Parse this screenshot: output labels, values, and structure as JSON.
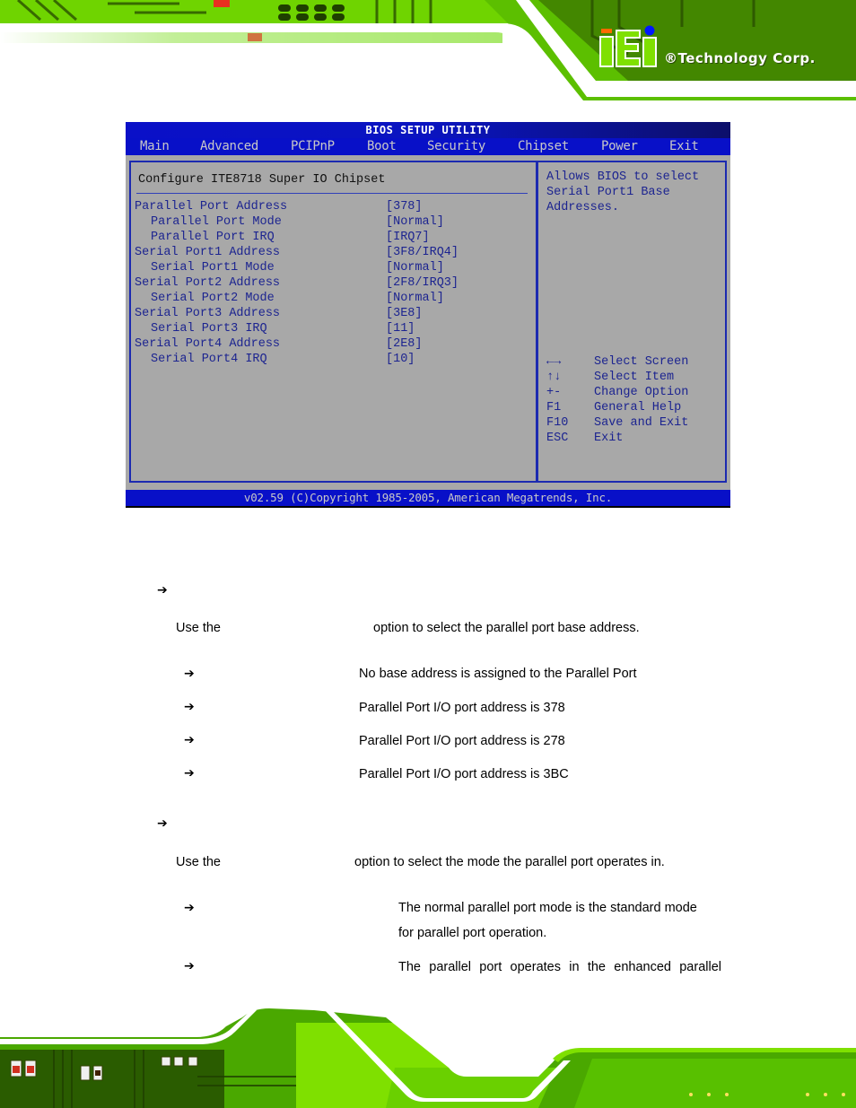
{
  "header": {
    "brand_mark": "iEi",
    "brand_text": "®Technology Corp.",
    "colors": {
      "pcb_green": "#7fe000",
      "pcb_dark": "#1e3a00",
      "logo_orange": "#ff6a00",
      "logo_blue": "#0018ff"
    }
  },
  "bios": {
    "title": "BIOS SETUP UTILITY",
    "menu": [
      {
        "label": "Main"
      },
      {
        "label": "Advanced"
      },
      {
        "label": "PCIPnP"
      },
      {
        "label": "Boot"
      },
      {
        "label": "Security"
      },
      {
        "label": "Chipset"
      },
      {
        "label": "Power"
      },
      {
        "label": "Exit"
      }
    ],
    "section_title": "Configure ITE8718 Super IO Chipset",
    "options": [
      {
        "label": "Parallel Port Address",
        "value": "[378]",
        "indent": false
      },
      {
        "label": "Parallel Port Mode",
        "value": "[Normal]",
        "indent": true
      },
      {
        "label": "Parallel Port IRQ",
        "value": "[IRQ7]",
        "indent": true
      },
      {
        "label": "Serial Port1 Address",
        "value": "[3F8/IRQ4]",
        "indent": false
      },
      {
        "label": "Serial Port1 Mode",
        "value": "[Normal]",
        "indent": true
      },
      {
        "label": "Serial Port2 Address",
        "value": "[2F8/IRQ3]",
        "indent": false
      },
      {
        "label": "Serial Port2 Mode",
        "value": "[Normal]",
        "indent": true
      },
      {
        "label": "Serial Port3 Address",
        "value": "[3E8]",
        "indent": false
      },
      {
        "label": "Serial Port3 IRQ",
        "value": "[11]",
        "indent": true
      },
      {
        "label": "Serial Port4 Address",
        "value": "[2E8]",
        "indent": false
      },
      {
        "label": "Serial Port4 IRQ",
        "value": "[10]",
        "indent": true
      }
    ],
    "help_text": "Allows BIOS to select\nSerial Port1 Base\nAddresses.",
    "keys": [
      {
        "key": "←→",
        "desc": "Select Screen"
      },
      {
        "key": "↑↓",
        "desc": "Select Item"
      },
      {
        "key": "+-",
        "desc": "Change Option"
      },
      {
        "key": "F1",
        "desc": "General Help"
      },
      {
        "key": "F10",
        "desc": "Save and Exit"
      },
      {
        "key": "ESC",
        "desc": "Exit"
      }
    ],
    "footer": "v02.59 (C)Copyright 1985-2005, American Megatrends, Inc.",
    "colors": {
      "bar_blue": "#0810c8",
      "panel_gray": "#a8a8a8",
      "text_blue": "#1c2490",
      "menu_text": "#c8c8c8"
    }
  },
  "document": {
    "bullet_glyph": "➔",
    "section1": {
      "intro_before": "Use the",
      "intro_after": "option to select the parallel port base address.",
      "items": [
        {
          "desc": "No base address is assigned to the Parallel Port"
        },
        {
          "desc": "Parallel Port I/O port address is 378"
        },
        {
          "desc": "Parallel Port I/O port address is 278"
        },
        {
          "desc": "Parallel Port I/O port address is 3BC"
        }
      ]
    },
    "section2": {
      "intro_before": "Use the",
      "intro_after": "option to select the mode the parallel port operates in.",
      "items": [
        {
          "desc_line1": "The normal parallel port mode is the standard mode",
          "desc_line2": "for parallel port operation."
        },
        {
          "desc_line1": "The parallel port operates in the enhanced parallel"
        }
      ]
    }
  }
}
